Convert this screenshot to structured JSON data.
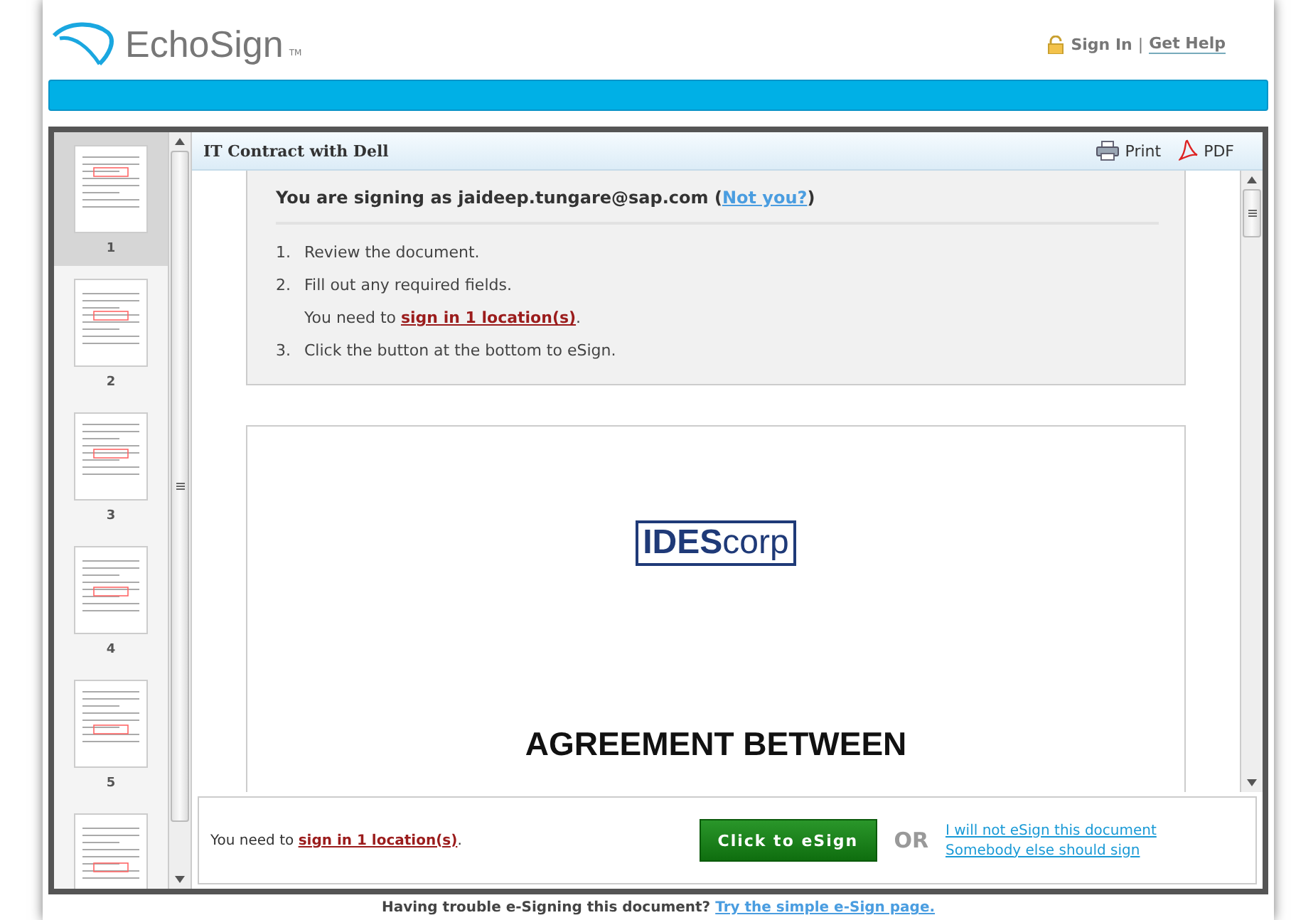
{
  "header": {
    "logo": "EchoSign",
    "logo_mark": "TM",
    "links": [
      {
        "label": "Sign In"
      },
      {
        "label": "Get Help"
      }
    ],
    "separator": "|"
  },
  "document": {
    "title": "IT Contract with Dell",
    "actions": [
      {
        "kind": "print",
        "label": "Print"
      },
      {
        "kind": "pdf",
        "label": "PDF"
      }
    ]
  },
  "thumbnails": [
    {
      "label": "1",
      "selected": true
    },
    {
      "label": "2",
      "selected": false
    },
    {
      "label": "3",
      "selected": false
    },
    {
      "label": "4",
      "selected": false
    },
    {
      "label": "5",
      "selected": false
    },
    {
      "selected": false
    }
  ],
  "instructions": {
    "signing_as": "You are signing as jaideep.tungare@sap.com (",
    "not_you": "Not you?",
    "close": ")",
    "steps": [
      {
        "number": "1.",
        "text": "Review the document."
      },
      {
        "number": "2.",
        "text": "Fill out any required fields.",
        "note": "You need to ",
        "note_link": "sign in 1 location(s)",
        "note_end": "."
      },
      {
        "number": "3.",
        "text": "Click the button at the bottom to eSign."
      }
    ]
  },
  "page": {
    "logo": "**IDES**corp",
    "heading": "AGREEMENT BETWEEN"
  },
  "sign_bar": {
    "note": "You need to ",
    "note_link": "sign in 1 location(s)",
    "note_end": ".",
    "button": "Click to eSign",
    "or": "OR",
    "links": [
      "I will not eSign this document",
      "Somebody else should sign"
    ]
  },
  "footer": {
    "text": "Having trouble e-Signing this document?",
    "link": "Try the simple e-Sign page."
  }
}
